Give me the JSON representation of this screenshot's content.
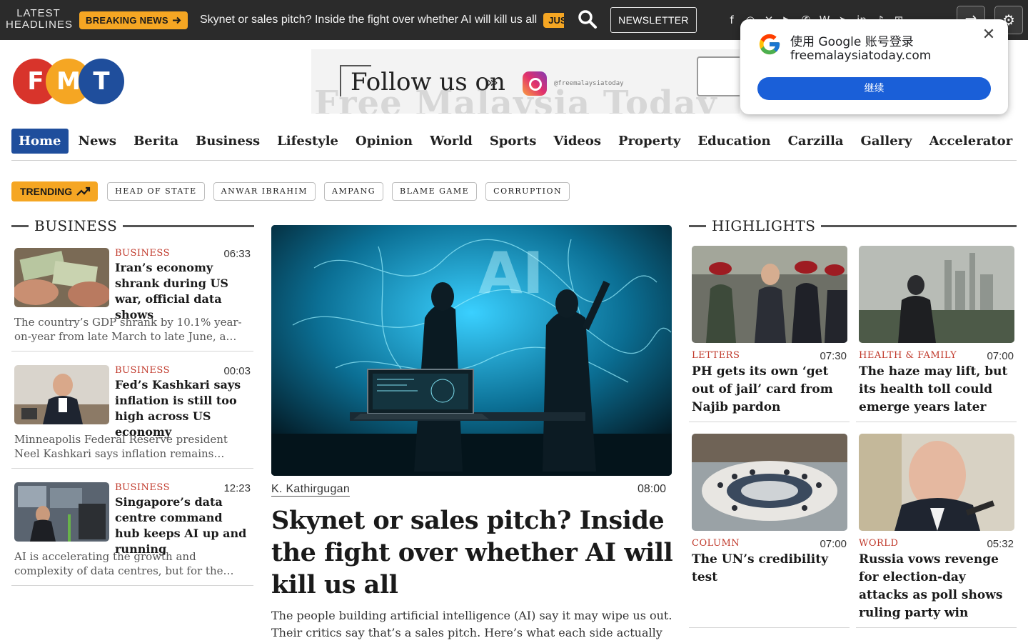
{
  "topbar": {
    "latest_line1": "LATEST",
    "latest_line2": "HEADLINES",
    "breaking_label": "BREAKING NEWS",
    "ticker_text": "Skynet or sales pitch? Inside the fight over whether AI will kill us all",
    "ticker_next_badge": "JUS",
    "newsletter_label": "NEWSLETTER",
    "social_icons": [
      "facebook-icon",
      "instagram-icon",
      "x-icon",
      "youtube-icon",
      "whatsapp-icon",
      "wikipedia-icon",
      "telegram-icon",
      "linkedin-icon",
      "tiktok-icon",
      "rss-icon"
    ]
  },
  "logo": {
    "letters": [
      "F",
      "M",
      "T"
    ],
    "colors": [
      "#d8342b",
      "#f5a623",
      "#1f4e9c"
    ]
  },
  "ad": {
    "big_text": "Free Malaysia Today",
    "follow_text": "Follow us on",
    "handle": "@freemalaysiatoday"
  },
  "nav": {
    "items": [
      "Home",
      "News",
      "Berita",
      "Business",
      "Lifestyle",
      "Opinion",
      "World",
      "Sports",
      "Videos",
      "Property",
      "Education",
      "Carzilla",
      "Gallery",
      "Accelerator"
    ],
    "active": "Home"
  },
  "trending": {
    "label": "TRENDING",
    "tags": [
      "HEAD OF STATE",
      "ANWAR IBRAHIM",
      "AMPANG",
      "BLAME GAME",
      "CORRUPTION"
    ]
  },
  "business": {
    "heading": "BUSINESS",
    "items": [
      {
        "category": "BUSINESS",
        "time": "06:33",
        "title": "Iran’s economy shrank during US war, official data shows",
        "excerpt": "The country’s GDP shrank by 10.1% year-on-year from late March to late June, a period marked by the war."
      },
      {
        "category": "BUSINESS",
        "time": "00:03",
        "title": "Fed’s Kashkari says inflation is still too high across US economy",
        "excerpt": "Minneapolis Federal Reserve president Neel Kashkari says inflation remains elevated across the economy."
      },
      {
        "category": "BUSINESS",
        "time": "12:23",
        "title": "Singapore’s data centre command hub keeps AI up and running",
        "excerpt": "AI is accelerating the growth and complexity of data centres, but for the engineers who run them."
      }
    ]
  },
  "main_story": {
    "author": "K. Kathirgugan",
    "time": "08:00",
    "title": "Skynet or sales pitch? Inside the fight over whether AI will kill us all",
    "excerpt": "The people building artificial intelligence (AI) say it may wipe us out. Their critics say that’s a sales pitch. Here’s what each side actually argues,"
  },
  "highlights": {
    "heading": "HIGHLIGHTS",
    "items": [
      {
        "category": "LETTERS",
        "time": "07:30",
        "title": "PH gets its own ‘get out of jail’ card from Najib pardon"
      },
      {
        "category": "HEALTH & FAMILY",
        "time": "07:00",
        "title": "The haze may lift, but its health toll could emerge years later"
      },
      {
        "category": "COLUMN",
        "time": "07:00",
        "title": "The UN’s credibility test"
      },
      {
        "category": "WORLD",
        "time": "05:32",
        "title": "Russia vows revenge for election-day attacks as poll shows ruling party win"
      }
    ]
  },
  "google_popup": {
    "title": "使用 Google 账号登录",
    "domain": "freemalaysiatoday.com",
    "continue_label": "继续"
  },
  "colors": {
    "accent_orange": "#f5a623",
    "nav_active_blue": "#1f4e9c",
    "category_red": "#c0392b",
    "topbar_bg": "#2b2b2b",
    "google_blue": "#1a5fd8"
  }
}
